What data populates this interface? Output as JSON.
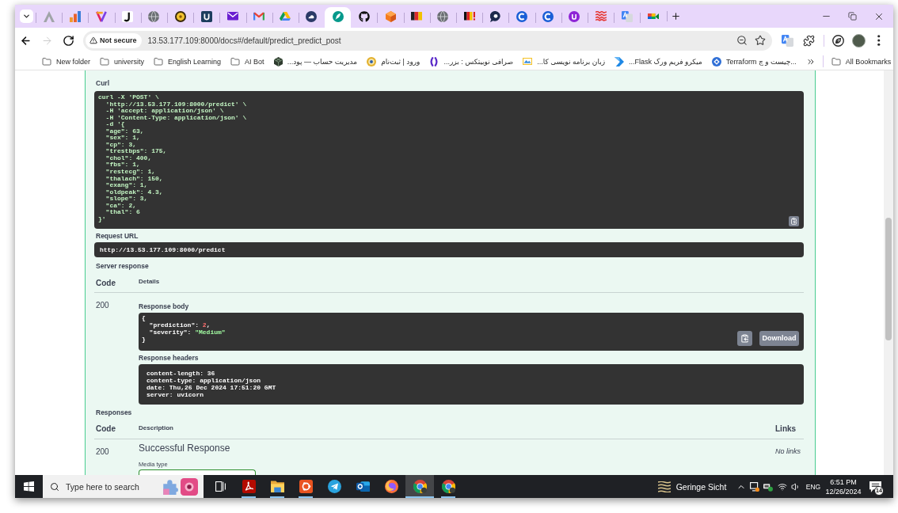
{
  "browser": {
    "tabs": [
      {
        "selected": false
      },
      {
        "selected": false
      },
      {
        "selected": false
      },
      {
        "selected": false
      },
      {
        "selected": false
      },
      {
        "selected": false
      },
      {
        "selected": false
      },
      {
        "selected": false
      },
      {
        "selected": false
      },
      {
        "selected": false
      },
      {
        "selected": false
      },
      {
        "selected": true
      },
      {
        "selected": false
      },
      {
        "selected": false
      },
      {
        "selected": false
      },
      {
        "selected": false
      },
      {
        "selected": false
      },
      {
        "selected": false
      },
      {
        "selected": false
      },
      {
        "selected": false
      },
      {
        "selected": false
      },
      {
        "selected": false
      },
      {
        "selected": false
      },
      {
        "selected": false
      }
    ],
    "nav_buttons": [
      {
        "kind": "back",
        "disabled": false
      },
      {
        "kind": "forward",
        "disabled": true
      },
      {
        "kind": "reload",
        "disabled": false
      }
    ],
    "address_bar": {
      "security_label": "Not secure",
      "url": "13.53.177.109:8000/docs#/default/predict_predict_post"
    },
    "bookmarks": [
      {
        "kind": "folder",
        "label": "New folder"
      },
      {
        "kind": "folder",
        "label": "university"
      },
      {
        "kind": "folder",
        "label": "English Learning"
      },
      {
        "kind": "folder",
        "label": "AI Bot"
      },
      {
        "kind": "site",
        "label": "مدیریت حساب — پود..."
      },
      {
        "kind": "site",
        "label": "ورود | ثبت‌نام"
      },
      {
        "kind": "site",
        "label": "صرافی نوبیتکس : بزر..."
      },
      {
        "kind": "site",
        "label": "زبان برنامه نویسی کا..."
      },
      {
        "kind": "site",
        "label": "میکرو فریم ورک Flask..."
      },
      {
        "kind": "site",
        "label": "Terraform چیست و چ..."
      }
    ],
    "all_bookmarks": "All Bookmarks"
  },
  "page": {
    "curl": {
      "label": "Curl",
      "lines": [
        "curl -X 'POST' \\",
        "  'http://13.53.177.109:8000/predict' \\",
        "  -H 'accept: application/json' \\",
        "  -H 'Content-Type: application/json' \\",
        "  -d '{",
        "  \"age\": 63,",
        "  \"sex\": 1,",
        "  \"cp\": 3,",
        "  \"trestbps\": 175,",
        "  \"chol\": 400,",
        "  \"fbs\": 1,",
        "  \"restecg\": 1,",
        "  \"thalach\": 150,",
        "  \"exang\": 1,",
        "  \"oldpeak\": 4.3,",
        "  \"slope\": 3,",
        "  \"ca\": 2,",
        "  \"thal\": 6",
        "}'"
      ]
    },
    "request_url": {
      "label": "Request URL",
      "value": "http://13.53.177.109:8000/predict"
    },
    "server_response": {
      "label": "Server response",
      "columns": [
        "Code",
        "Details"
      ],
      "code": "200",
      "body_label": "Response body",
      "body_lines": [
        "{",
        "  \"prediction\": 2,",
        "  \"severity\": \"Medium\"",
        "}"
      ],
      "download_label": "Download",
      "headers_label": "Response headers",
      "header_lines": [
        "content-length: 36",
        "content-type: application/json",
        "date: Thu,26 Dec 2024 17:51:20 GMT",
        "server: uvicorn"
      ]
    },
    "responses": {
      "label": "Responses",
      "columns": [
        "Code",
        "Description",
        "Links"
      ],
      "rows": [
        {
          "code": "200",
          "description": "Successful Response",
          "links": "No links",
          "media_type_label": "Media type"
        }
      ]
    }
  },
  "taskbar": {
    "search_placeholder": "Type here to search",
    "apps": [
      {
        "running": true,
        "selected": false
      },
      {
        "running": true,
        "selected": false
      },
      {
        "running": true,
        "selected": false
      },
      {
        "running": false,
        "selected": false
      },
      {
        "running": false,
        "selected": false
      },
      {
        "running": false,
        "selected": false
      },
      {
        "running": true,
        "selected": true
      },
      {
        "running": true,
        "selected": false
      }
    ],
    "weather": "Geringe Sicht",
    "language": "ENG",
    "time": "6:51 PM",
    "date": "12/26/2024",
    "notification_count": "14"
  }
}
